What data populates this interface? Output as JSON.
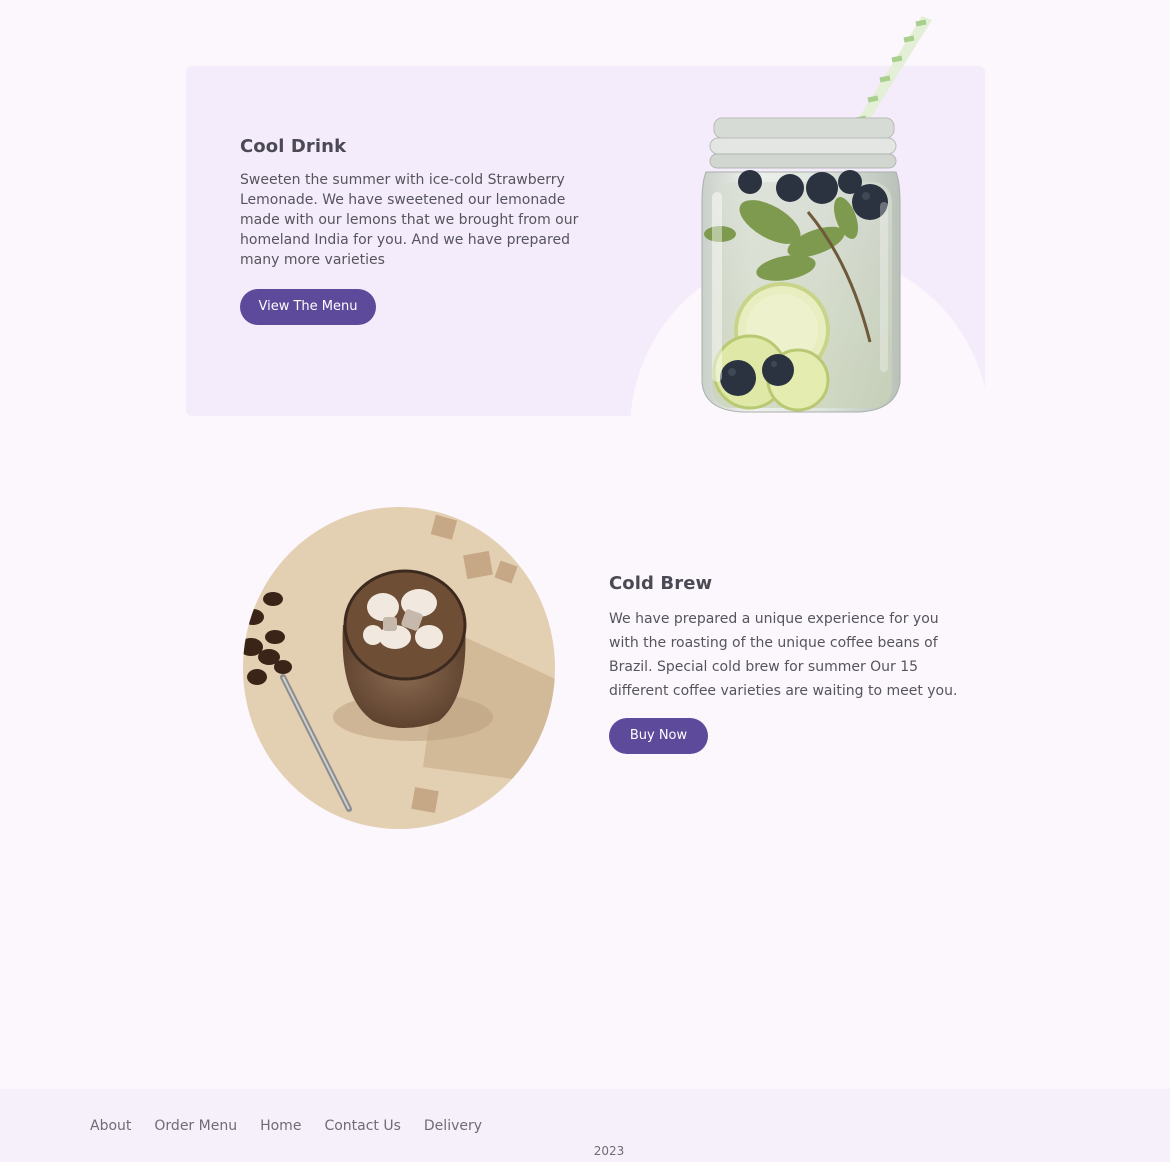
{
  "cool_drink": {
    "title": "Cool Drink",
    "description": "Sweeten the summer with ice-cold Strawberry Lemonade. We have sweetened our lemonade made with our lemons that we brought from our homeland India for you. And we have prepared many more varieties",
    "button_label": "View The Menu",
    "image_icon": "lemonade-jar-image"
  },
  "cold_brew": {
    "title": "Cold Brew",
    "description": "We have prepared a unique experience for you with the roasting of the unique coffee beans of Brazil. Special cold brew for summer Our 15 different coffee varieties are waiting to meet you.",
    "button_label": "Buy Now",
    "image_icon": "iced-coffee-image"
  },
  "footer": {
    "links": [
      "About",
      "Order Menu",
      "Home",
      "Contact Us",
      "Delivery"
    ],
    "year": "2023"
  },
  "colors": {
    "accent": "#5e4a9a",
    "card_background": "#f4ecfb",
    "page_background": "#fbf7fd"
  }
}
